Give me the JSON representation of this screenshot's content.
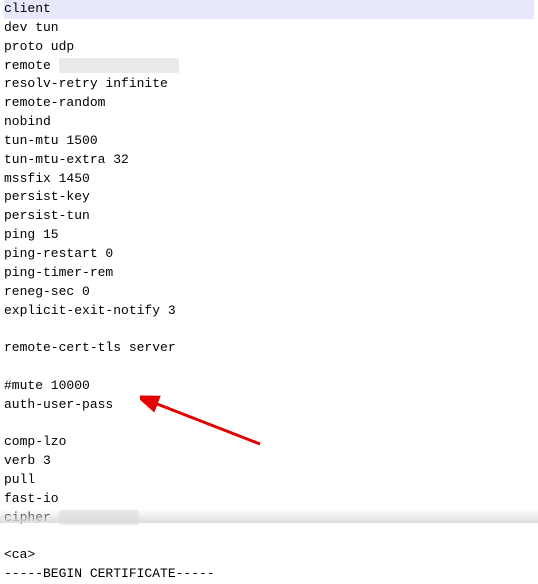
{
  "config": {
    "lines": [
      "client",
      "dev tun",
      "proto udp",
      "remote ",
      "resolv-retry infinite",
      "remote-random",
      "nobind",
      "tun-mtu 1500",
      "tun-mtu-extra 32",
      "mssfix 1450",
      "persist-key",
      "persist-tun",
      "ping 15",
      "ping-restart 0",
      "ping-timer-rem",
      "reneg-sec 0",
      "explicit-exit-notify 3",
      "",
      "remote-cert-tls server",
      "",
      "#mute 10000",
      "auth-user-pass",
      "",
      "comp-lzo",
      "verb 3",
      "pull",
      "fast-io",
      "cipher ",
      "",
      "<ca>",
      "-----BEGIN CERTIFICATE-----"
    ],
    "redacted_lines": [
      3,
      27
    ],
    "highlighted_line": 0,
    "arrow_target_line": 21
  },
  "annotation": {
    "arrow_color": "#e20000"
  }
}
